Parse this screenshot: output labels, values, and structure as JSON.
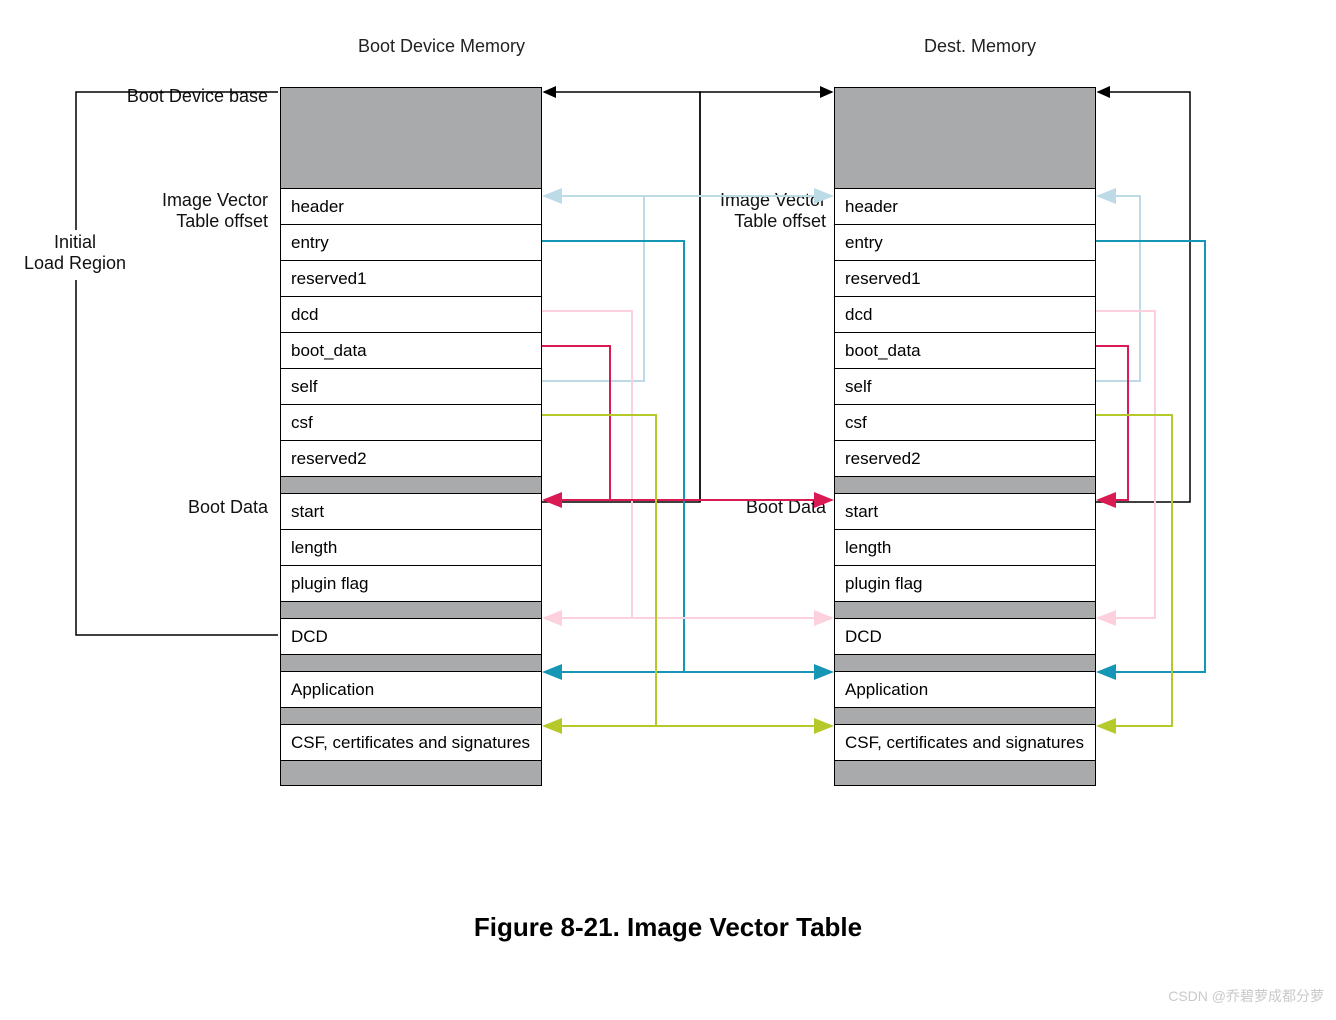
{
  "titles": {
    "left": "Boot Device Memory",
    "right": "Dest. Memory"
  },
  "labels": {
    "initial_load_region_l1": "Initial",
    "initial_load_region_l2": "Load Region",
    "boot_device_base": "Boot Device base",
    "ivt_offset_l1": "Image Vector",
    "ivt_offset_l2": "Table offset",
    "boot_data": "Boot Data"
  },
  "ivt": {
    "header": "header",
    "entry": "entry",
    "reserved1": "reserved1",
    "dcd": "dcd",
    "boot_data": "boot_data",
    "self": "self",
    "csf": "csf",
    "reserved2": "reserved2"
  },
  "bootdata": {
    "start": "start",
    "length": "length",
    "plugin": "plugin flag"
  },
  "sections": {
    "dcd": "DCD",
    "app": "Application",
    "csf": "CSF, certificates and signatures"
  },
  "caption": "Figure 8-21. Image Vector Table",
  "watermark": "CSDN @乔碧萝成都分萝",
  "colors": {
    "lightblue": "#bcdbe6",
    "teal": "#1596b4",
    "pink": "#fdd0de",
    "red": "#d91a53",
    "olive": "#b6c92b",
    "gray": "#a9aaac"
  }
}
